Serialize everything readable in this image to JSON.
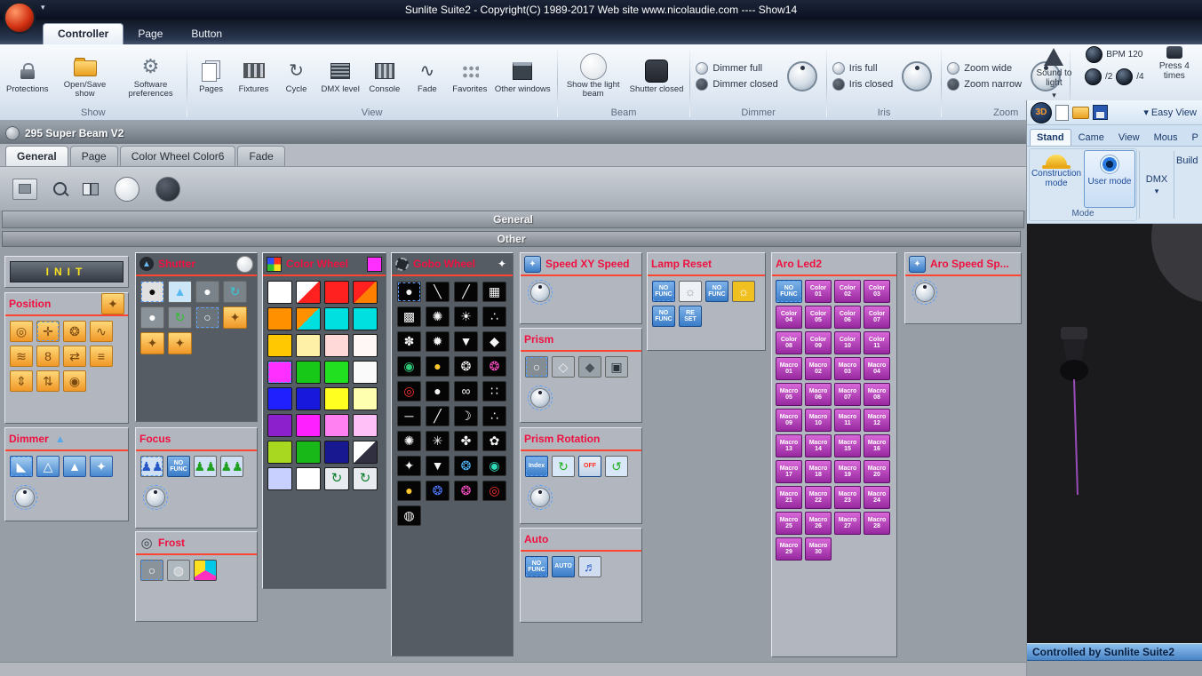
{
  "title_bar": {
    "title": "Sunlite Suite2 - Copyright(C) 1989-2017   Web site www.nicolaudie.com ---- Show14"
  },
  "ribbon": {
    "tabs": [
      {
        "label": "Controller"
      },
      {
        "label": "Page"
      },
      {
        "label": "Button"
      }
    ],
    "show_group": {
      "label": "Show",
      "items": [
        {
          "label": "Protections"
        },
        {
          "label": "Open/Save show"
        },
        {
          "label": "Software preferences"
        }
      ]
    },
    "view_group": {
      "label": "View",
      "items": [
        {
          "label": "Pages"
        },
        {
          "label": "Fixtures"
        },
        {
          "label": "Cycle"
        },
        {
          "label": "DMX level"
        },
        {
          "label": "Console"
        },
        {
          "label": "Fade"
        },
        {
          "label": "Favorites"
        },
        {
          "label": "Other windows"
        }
      ]
    },
    "beam_group": {
      "label": "Beam",
      "items": [
        {
          "label": "Show the light beam"
        },
        {
          "label": "Shutter closed"
        }
      ]
    },
    "dimmer_group": {
      "label": "Dimmer",
      "options": [
        "Dimmer full",
        "Dimmer closed"
      ]
    },
    "iris_group": {
      "label": "Iris",
      "options": [
        "Iris full",
        "Iris closed"
      ]
    },
    "zoom_group": {
      "label": "Zoom",
      "options": [
        "Zoom wide",
        "Zoom narrow"
      ]
    },
    "sound_group": {
      "sound_to_light": "Sound to light",
      "bpm": "BPM 120",
      "div2": "/2",
      "div4": "/4",
      "press": "Press 4 times"
    }
  },
  "fixture_window": {
    "title": "295 Super Beam V2",
    "tabs": [
      {
        "label": "General"
      },
      {
        "label": "Page"
      },
      {
        "label": "Color Wheel Color6"
      },
      {
        "label": "Fade"
      }
    ],
    "section_general": "General",
    "section_other": "Other"
  },
  "panels": {
    "init": {
      "title": "INIT"
    },
    "position": {
      "title": "Position",
      "cells": [
        {
          "g": "◎",
          "cls": "ob"
        },
        {
          "g": "✛",
          "cls": "ob",
          "sel": true
        },
        {
          "g": "❂",
          "cls": "ob"
        },
        {
          "g": "∿",
          "cls": "ob"
        },
        {
          "g": "≋",
          "cls": "ob"
        },
        {
          "g": "8",
          "cls": "ob"
        },
        {
          "g": "⇄",
          "cls": "ob"
        },
        {
          "g": "≡",
          "cls": "ob"
        },
        {
          "g": "⇕",
          "cls": "ob"
        },
        {
          "g": "⇅",
          "cls": "ob"
        },
        {
          "g": "◉",
          "cls": "ob"
        }
      ]
    },
    "dimmer": {
      "title": "Dimmer",
      "cells": [
        {
          "g": "◣",
          "cls": "bb",
          "sel": true
        },
        {
          "g": "△",
          "cls": "bb"
        },
        {
          "g": "▲",
          "cls": "bb"
        },
        {
          "g": "✦",
          "cls": "bb"
        }
      ]
    },
    "shutter": {
      "title": "Shutter",
      "cells": [
        {
          "g": "●",
          "fg": "#0a0a0a",
          "bg": "#e0e0e0",
          "sel": true
        },
        {
          "g": "▲",
          "fg": "#58b8f0",
          "bg": "#cce6f8"
        },
        {
          "g": "●",
          "fg": "#ffffff",
          "bg": "#7a828a"
        },
        {
          "g": "↻",
          "fg": "#38c8d8",
          "bg": "#7a828a"
        },
        {
          "g": "●",
          "fg": "#ffffff",
          "bg": "#8a929a"
        },
        {
          "g": "↻",
          "fg": "#30c030",
          "bg": "#8a929a"
        },
        {
          "g": "○",
          "fg": "#ffffff",
          "bg": "#6a727a",
          "sel": true
        },
        {
          "g": "✦",
          "cls": "ob"
        },
        {
          "g": "✦",
          "cls": "ob"
        },
        {
          "g": "✦",
          "cls": "ob"
        }
      ]
    },
    "focus": {
      "title": "Focus",
      "no_func": "NO FUNC",
      "cells": [
        {
          "g": "♟♟",
          "fg": "#2858c8",
          "bg": "#cfe0f4",
          "sel": true
        },
        {
          "g": "NO FUNC",
          "cls": "tb"
        },
        {
          "g": "♟♟",
          "fg": "#1fa020",
          "bg": "#cfe0f4"
        },
        {
          "g": "♟♟",
          "fg": "#1fa020",
          "bg": "#cfe0f4"
        }
      ]
    },
    "frost": {
      "title": "Frost",
      "cells": [
        {
          "g": "○",
          "fg": "#ffffff",
          "bg": "#8a929a",
          "sel": true
        },
        {
          "g": "◍",
          "fg": "#f0f0f0",
          "bg": "#aeb6be"
        },
        {
          "cls": "cmy"
        }
      ]
    },
    "color_wheel": {
      "title": "Color Wheel",
      "swatches": [
        {
          "c1": "#ffffff"
        },
        {
          "c1": "#ffffff",
          "c2": "#ff2020"
        },
        {
          "c1": "#ff2020"
        },
        {
          "c1": "#ff2020",
          "c2": "#ff8000"
        },
        {
          "c1": "#ff9000"
        },
        {
          "c1": "#ff9000",
          "c2": "#00e0e0"
        },
        {
          "c1": "#00e0e0"
        },
        {
          "c1": "#00e0e0"
        },
        {
          "c1": "#ffc800"
        },
        {
          "c1": "#fff0a8"
        },
        {
          "c1": "#ffd8d8"
        },
        {
          "c1": "#fff6f6"
        },
        {
          "c1": "#ff30ff",
          "sel": true
        },
        {
          "c1": "#18c818"
        },
        {
          "c1": "#20e020"
        },
        {
          "c1": "#fafafa"
        },
        {
          "c1": "#2020ff"
        },
        {
          "c1": "#1818dc"
        },
        {
          "c1": "#ffff20"
        },
        {
          "c1": "#ffffb0"
        },
        {
          "c1": "#8c20cc"
        },
        {
          "c1": "#ff20ff"
        },
        {
          "c1": "#ff80f0"
        },
        {
          "c1": "#ffc0f8"
        },
        {
          "c1": "#a8d820"
        },
        {
          "c1": "#18b818"
        },
        {
          "c1": "#181890"
        },
        {
          "c1": "#ffffff",
          "c2": "#303040"
        },
        {
          "c1": "#c8d0ff"
        },
        {
          "c1": "#ffffff"
        },
        {
          "g": "↻",
          "cls": "rot"
        },
        {
          "g": "↻",
          "cls": "rot"
        }
      ]
    },
    "gobo_wheel": {
      "title": "Gobo Wheel",
      "cells": [
        {
          "g": "●",
          "cls": "gb",
          "sel": true
        },
        {
          "g": "╲",
          "cls": "gb"
        },
        {
          "g": "╱",
          "cls": "gb"
        },
        {
          "g": "▦",
          "cls": "gb"
        },
        {
          "g": "▩",
          "cls": "gb"
        },
        {
          "g": "✺",
          "cls": "gb"
        },
        {
          "g": "☀",
          "cls": "gb"
        },
        {
          "g": "∴",
          "cls": "gb"
        },
        {
          "g": "✽",
          "cls": "gb"
        },
        {
          "g": "✹",
          "cls": "gb"
        },
        {
          "g": "▼",
          "cls": "gb"
        },
        {
          "g": "◆",
          "cls": "gb"
        },
        {
          "g": "◉",
          "cls": "gb",
          "fg": "#30c878"
        },
        {
          "g": "●",
          "cls": "gb",
          "fg": "#ffc830"
        },
        {
          "g": "❂",
          "cls": "gb"
        },
        {
          "g": "❂",
          "cls": "gb",
          "fg": "#ff50c8"
        },
        {
          "g": "◎",
          "cls": "gb",
          "fg": "#ff3030"
        },
        {
          "g": "●",
          "cls": "gb"
        },
        {
          "g": "∞",
          "cls": "gb"
        },
        {
          "g": "∷",
          "cls": "gb"
        },
        {
          "g": "─",
          "cls": "gb"
        },
        {
          "g": "╱",
          "cls": "gb"
        },
        {
          "g": "☽",
          "cls": "gb"
        },
        {
          "g": "∴",
          "cls": "gb"
        },
        {
          "g": "✺",
          "cls": "gb"
        },
        {
          "g": "✳",
          "cls": "gb"
        },
        {
          "g": "✤",
          "cls": "gb"
        },
        {
          "g": "✿",
          "cls": "gb"
        },
        {
          "g": "✦",
          "cls": "gb"
        },
        {
          "g": "▼",
          "cls": "gb"
        },
        {
          "g": "❂",
          "cls": "gb",
          "fg": "#50b8ff"
        },
        {
          "g": "◉",
          "cls": "gb",
          "fg": "#30d8b8"
        },
        {
          "g": "●",
          "cls": "gb",
          "fg": "#ffc830"
        },
        {
          "g": "❂",
          "cls": "gb",
          "fg": "#5078ff"
        },
        {
          "g": "❂",
          "cls": "gb",
          "fg": "#ff50c8"
        },
        {
          "g": "◎",
          "cls": "gb",
          "fg": "#ff3030"
        },
        {
          "g": "◍",
          "cls": "gb"
        }
      ]
    },
    "speed_xy": {
      "title": "Speed XY Speed"
    },
    "prism": {
      "title": "Prism",
      "cells": [
        {
          "g": "○",
          "fg": "#ffffff",
          "bg": "#848c94",
          "sel": true
        },
        {
          "g": "◇",
          "fg": "#f0f0f0",
          "bg": "#b0b6be"
        },
        {
          "g": "◆",
          "fg": "#4a525a",
          "bg": "#9aa2aa"
        },
        {
          "g": "▣",
          "fg": "#2a323a",
          "bg": "#a8b0b8"
        }
      ]
    },
    "prism_rotation": {
      "title": "Prism Rotation",
      "cells": [
        {
          "g": "Index",
          "cls": "tb",
          "sel": true
        },
        {
          "g": "↻",
          "fg": "#20b020",
          "bg": "#d8e8f8"
        },
        {
          "g": "OFF",
          "cls": "tb off"
        },
        {
          "g": "↺",
          "fg": "#20b020",
          "bg": "#d8e8f8"
        }
      ]
    },
    "auto": {
      "title": "Auto",
      "cells": [
        {
          "g": "NO FUNC",
          "cls": "tb",
          "sel": true
        },
        {
          "g": "AUTO",
          "cls": "tb"
        },
        {
          "g": "♬",
          "fg": "#2858c8",
          "bg": "#d0ddf0"
        }
      ]
    },
    "lamp_reset": {
      "title": "Lamp Reset",
      "cells": [
        {
          "g": "NO FUNC",
          "cls": "tb",
          "sel": true
        },
        {
          "g": "☼",
          "fg": "#9aa2aa",
          "bg": "#eef2f6"
        },
        {
          "g": "NO FUNC",
          "cls": "tb"
        },
        {
          "g": "☼",
          "fg": "#ffffff",
          "bg": "#f0c020"
        },
        {
          "g": "NO FUNC",
          "cls": "tb"
        },
        {
          "g": "RE SET",
          "cls": "tb"
        }
      ]
    },
    "aro_led2": {
      "title": "Aro Led2",
      "cells": [
        {
          "g": "NO FUNC",
          "cls": "tb",
          "sel": true
        },
        {
          "g": "Color 01",
          "cls": "mb"
        },
        {
          "g": "Color 02",
          "cls": "mb"
        },
        {
          "g": "Color 03",
          "cls": "mb"
        },
        {
          "g": "Color 04",
          "cls": "mb"
        },
        {
          "g": "Color 05",
          "cls": "mb"
        },
        {
          "g": "Color 06",
          "cls": "mb"
        },
        {
          "g": "Color 07",
          "cls": "mb"
        },
        {
          "g": "Color 08",
          "cls": "mb"
        },
        {
          "g": "Color 09",
          "cls": "mb"
        },
        {
          "g": "Color 10",
          "cls": "mb"
        },
        {
          "g": "Color 11",
          "cls": "mb"
        },
        {
          "g": "Macro 01",
          "cls": "mb"
        },
        {
          "g": "Macro 02",
          "cls": "mb"
        },
        {
          "g": "Macro 03",
          "cls": "mb"
        },
        {
          "g": "Macro 04",
          "cls": "mb"
        },
        {
          "g": "Macro 05",
          "cls": "mb"
        },
        {
          "g": "Macro 06",
          "cls": "mb"
        },
        {
          "g": "Macro 07",
          "cls": "mb"
        },
        {
          "g": "Macro 08",
          "cls": "mb"
        },
        {
          "g": "Macro 09",
          "cls": "mb"
        },
        {
          "g": "Macro 10",
          "cls": "mb"
        },
        {
          "g": "Macro 11",
          "cls": "mb"
        },
        {
          "g": "Macro 12",
          "cls": "mb"
        },
        {
          "g": "Macro 13",
          "cls": "mb"
        },
        {
          "g": "Macro 14",
          "cls": "mb"
        },
        {
          "g": "Macro 15",
          "cls": "mb"
        },
        {
          "g": "Macro 16",
          "cls": "mb"
        },
        {
          "g": "Macro 17",
          "cls": "mb"
        },
        {
          "g": "Macro 18",
          "cls": "mb"
        },
        {
          "g": "Macro 19",
          "cls": "mb"
        },
        {
          "g": "Macro 20",
          "cls": "mb"
        },
        {
          "g": "Macro 21",
          "cls": "mb"
        },
        {
          "g": "Macro 22",
          "cls": "mb"
        },
        {
          "g": "Macro 23",
          "cls": "mb"
        },
        {
          "g": "Macro 24",
          "cls": "mb"
        },
        {
          "g": "Macro 25",
          "cls": "mb"
        },
        {
          "g": "Macro 26",
          "cls": "mb"
        },
        {
          "g": "Macro 27",
          "cls": "mb"
        },
        {
          "g": "Macro 28",
          "cls": "mb"
        },
        {
          "g": "Macro 29",
          "cls": "mb"
        },
        {
          "g": "Macro 30",
          "cls": "mb"
        }
      ]
    },
    "aro_speed": {
      "title": "Aro Speed Sp..."
    }
  },
  "viewer": {
    "badge": "3D",
    "easy_view": "Easy View",
    "tabs": [
      {
        "label": "Stand"
      },
      {
        "label": "Came"
      },
      {
        "label": "View"
      },
      {
        "label": "Mous"
      },
      {
        "label": "P"
      }
    ],
    "mode_group": {
      "construction": "Construction mode",
      "user": "User mode",
      "caption": "Mode",
      "dmx": "DMX",
      "build": "Build"
    },
    "status": "Controlled by Sunlite Suite2"
  }
}
